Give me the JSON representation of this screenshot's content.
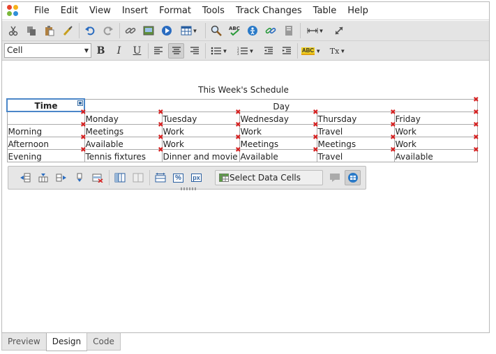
{
  "menubar": {
    "items": [
      "File",
      "Edit",
      "View",
      "Insert",
      "Format",
      "Tools",
      "Track Changes",
      "Table",
      "Help"
    ]
  },
  "toolbar1": {
    "buttons": [
      "cut-icon",
      "copy-icon",
      "paste-icon",
      "format-painter-icon",
      "undo-icon",
      "redo-icon",
      "link-icon",
      "image-icon",
      "media-icon",
      "table-icon",
      "find-icon",
      "spellcheck-icon",
      "accessibility-icon",
      "unlink-icon",
      "template-icon",
      "horizontal-rule-icon",
      "fullscreen-icon"
    ]
  },
  "toolbar2": {
    "style_value": "Cell",
    "buttons": [
      "bold-icon",
      "italic-icon",
      "underline-icon",
      "align-left-icon",
      "align-center-icon",
      "align-right-icon",
      "bullet-list-icon",
      "numbered-list-icon",
      "indent-icon",
      "outdent-icon",
      "highlight-icon",
      "clear-format-icon"
    ],
    "bold_label": "B",
    "italic_label": "I",
    "underline_label": "U",
    "highlight_label": "ABC",
    "clear_label": "Tx"
  },
  "document": {
    "caption": "This Week's Schedule",
    "header_time": "Time",
    "header_day": "Day",
    "days": [
      "Monday",
      "Tuesday",
      "Wednesday",
      "Thursday",
      "Friday"
    ],
    "rows": [
      {
        "label": "Morning",
        "cells": [
          "Meetings",
          "Work",
          "Work",
          "Travel",
          "Work"
        ]
      },
      {
        "label": "Afternoon",
        "cells": [
          "Available",
          "Work",
          "Meetings",
          "Meetings",
          "Work"
        ]
      },
      {
        "label": "Evening",
        "cells": [
          "Tennis fixtures",
          "Dinner and movie",
          "Available",
          "Travel",
          "Available"
        ]
      }
    ]
  },
  "table_toolbar": {
    "select_data_cells_label": "Select Data Cells",
    "px_label": "px",
    "percent_label": "%"
  },
  "bottom_tabs": [
    "Preview",
    "Design",
    "Code"
  ],
  "active_tab": "Design",
  "colors": {
    "toolbar_bg": "#e4e4e4",
    "selection_border": "#4a86c8",
    "delete_marker": "#d72020"
  }
}
